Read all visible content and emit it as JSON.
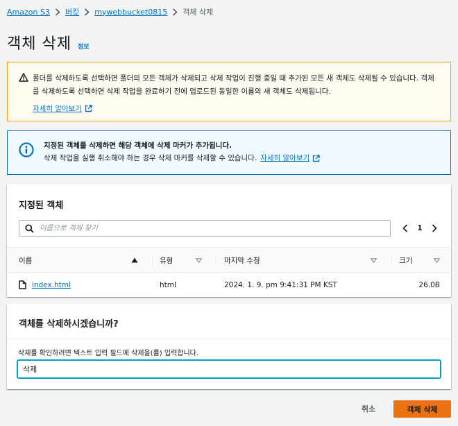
{
  "breadcrumb": [
    "Amazon S3",
    "버킷",
    "mywebbucket0815",
    "객체 삭제"
  ],
  "page": {
    "title": "객체 삭제",
    "info_link": "정보"
  },
  "warning": {
    "text": "폴더를 삭제하도록 선택하면 폴더의 모든 객체가 삭제되고 삭제 작업이 진행 중일 때 추가된 모든 새 객체도 삭제될 수 있습니다. 객체를 삭제하도록 선택하면 삭제 작업을 완료하기 전에 업로드된 동일한 이름의 새 객체도 삭제됩니다.",
    "learn_more": "자세히 알아보기"
  },
  "info": {
    "title": "지정된 객체를 삭제하면 해당 객체에 삭제 마커가 추가됩니다.",
    "desc": "삭제 작업을 실행 취소해야 하는 경우 삭제 마커를 삭제할 수 있습니다.",
    "learn_more": "자세히 알아보기"
  },
  "objects_panel": {
    "title": "지정된 객체",
    "search_placeholder": "이름으로 객체 찾기",
    "page": "1",
    "columns": [
      "이름",
      "유형",
      "마지막 수정",
      "크기"
    ],
    "rows": [
      {
        "name": "index.html",
        "type": "html",
        "modified": "2024. 1. 9. pm 9:41:31 PM KST",
        "size": "26.0B"
      }
    ]
  },
  "confirm_panel": {
    "title": "객체를 삭제하시겠습니까?",
    "label": "삭제를 확인하려면 텍스트 입력 필드에 삭제을(를) 입력합니다.",
    "input_value": "삭제"
  },
  "actions": {
    "cancel": "취소",
    "delete": "객체 삭제"
  },
  "colors": {
    "link": "#0073bb",
    "primary": "#ec7211",
    "warning_border": "#ff9900",
    "info_border": "#0073bb"
  }
}
